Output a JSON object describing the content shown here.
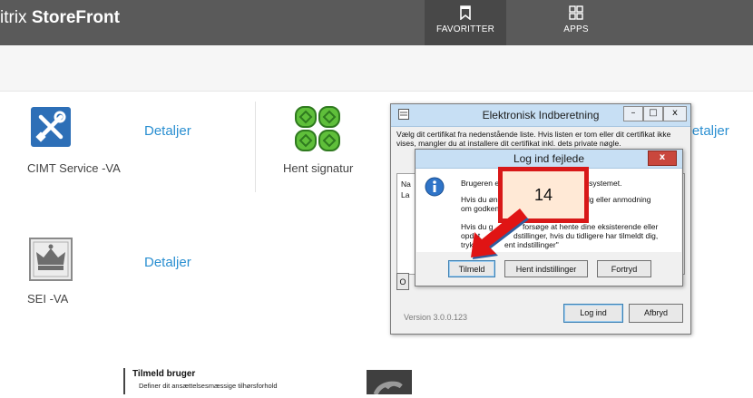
{
  "header": {
    "brand_prefix": "itrix",
    "brand_bold": "StoreFront",
    "tabs": [
      {
        "label": "FAVORITTER",
        "icon": "bookmark-icon",
        "active": true
      },
      {
        "label": "APPS",
        "icon": "apps-grid-icon",
        "active": false
      }
    ]
  },
  "apps": [
    {
      "name": "CIMT Service -VA",
      "details": "Detaljer",
      "icon": "tools-icon"
    },
    {
      "name": "Hent signatur",
      "details": "Detaljer",
      "icon": "signature-clover-icon"
    },
    {
      "name": "SEI -VA",
      "details": "Detaljer",
      "icon": "crown-icon"
    }
  ],
  "main_dialog": {
    "title": "Elektronisk Indberetning",
    "controls": [
      "–",
      "□",
      "x"
    ],
    "description": "Vælg dit certifikat fra nedenstående liste. Hvis listen er tom eller dit certifikat ikke vises, mangler du at installere dit certifikat inkl. dets private nøgle.",
    "link_fragment": "er",
    "list_fragment_1": "Na",
    "list_fragment_2": "La",
    "side_button_fragment": "O",
    "version": "Version 3.0.0.123",
    "buttons": {
      "login": "Log ind",
      "cancel": "Afbryd"
    }
  },
  "error_dialog": {
    "title": "Log ind fejlede",
    "close": "x",
    "line1_a": "Brugeren er ikk",
    "line1_b": "e systemet.",
    "line2_a": "Hvis du ønsker",
    "line2_b": "lg eller anmodning",
    "line3_a": "om godkendel",
    "line4_a": "Hvis du g",
    "line4_b": "forsøge at hente dine eksisterende eller",
    "line5_a": "opdat",
    "line5_b": "dstillinger, hvis du tidligere har tilmeldt dig,",
    "line6_a": "tryk d",
    "line6_b": "ent indstillinger\"",
    "buttons": {
      "register": "Tilmeld",
      "fetch_settings": "Hent indstillinger",
      "regret": "Fortryd"
    }
  },
  "annotation": {
    "number": "14",
    "color": "#d81818"
  },
  "bottom": {
    "title": "Tilmeld bruger",
    "subtitle": "Definer dit ansættelsesmæssige tilhørsforhold"
  },
  "colors": {
    "topbar": "#5a5a5a",
    "link": "#2a8fd1",
    "tools_icon": "#2d6fb7",
    "clover": "#5fbf3a"
  }
}
